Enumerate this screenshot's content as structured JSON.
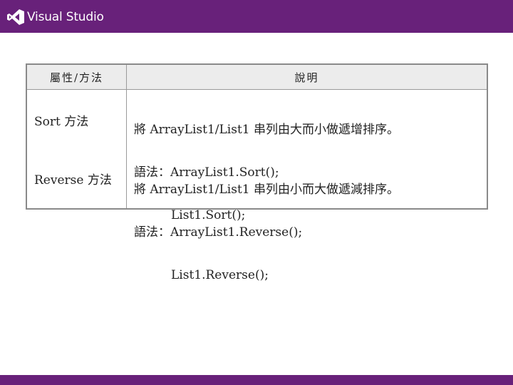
{
  "header": {
    "brand": "Visual Studio",
    "logo_icon": "visual-studio-logo-icon",
    "color": "#68217a"
  },
  "table": {
    "headers": [
      "屬性/方法",
      "說明"
    ],
    "methods": [
      "Sort 方法",
      "Reverse 方法"
    ],
    "descriptions": [
      {
        "summary": "將 ArrayList1/List1 串列由大而小做遞增排序。",
        "syntax_label": "語法：ArrayList1.Sort();",
        "syntax_line2": "List1.Sort();"
      },
      {
        "summary": "將 ArrayList1/List1 串列由小而大做遞減排序。",
        "syntax_label": "語法：ArrayList1.Reverse();",
        "syntax_line2": "List1.Reverse();"
      }
    ]
  }
}
